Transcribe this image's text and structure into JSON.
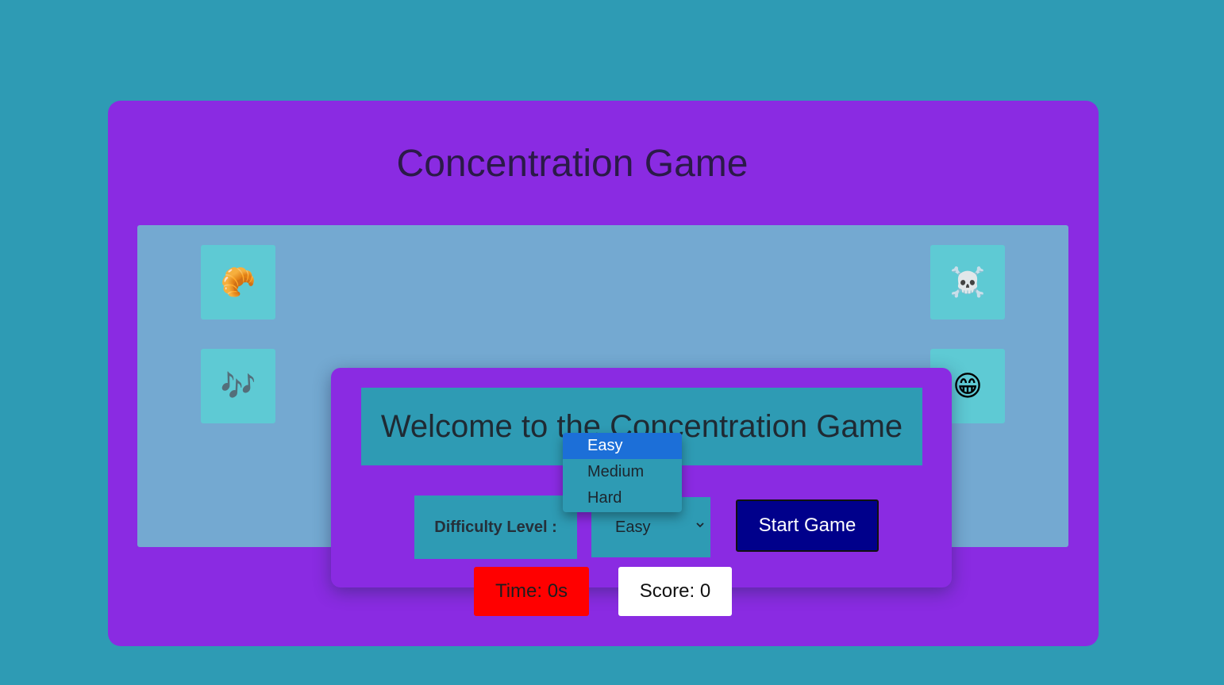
{
  "game": {
    "title": "Concentration Game",
    "cards": [
      {
        "emoji": "🥐",
        "icon": "croissant-icon"
      },
      {
        "emoji": "☠️",
        "icon": "skull-crossbones-icon"
      },
      {
        "emoji": "🎶",
        "icon": "music-notes-icon"
      },
      {
        "emoji": "😁",
        "icon": "grinning-face-icon"
      },
      {
        "emoji": "👍",
        "icon": "thumbs-up-icon"
      },
      {
        "emoji": "👽",
        "icon": "alien-icon"
      },
      {
        "emoji": "👽",
        "icon": "alien-icon"
      }
    ]
  },
  "modal": {
    "welcome": "Welcome to the Concentration Game",
    "difficulty_label": "Difficulty Level :",
    "selected": "Easy",
    "options": [
      "Easy",
      "Medium",
      "Hard"
    ],
    "start_label": "Start Game"
  },
  "stats": {
    "time": "Time: 0s",
    "score": "Score: 0"
  },
  "colors": {
    "background": "#2e9bb4",
    "panel": "#8a2be2",
    "board": "#74a9d1",
    "card": "#5ecad4",
    "start_button": "#00008b",
    "time_badge": "#ff0000",
    "score_badge": "#ffffff",
    "option_highlight": "#1c6fd8"
  }
}
